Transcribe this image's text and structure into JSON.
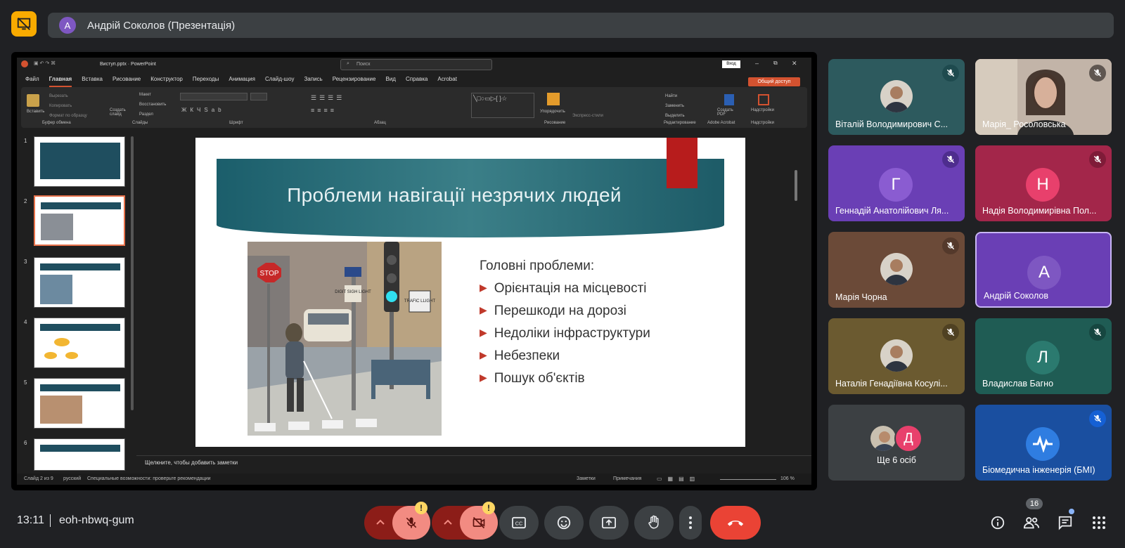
{
  "presenter": {
    "avatar_letter": "А",
    "label": "Андрій Соколов (Презентація)"
  },
  "ppt": {
    "filename": "Виступ.pptx  ·  PowerPoint",
    "search_placeholder": "Поиск",
    "signin": "Вход",
    "share": "Общий доступ",
    "menu": [
      "Файл",
      "Главная",
      "Вставка",
      "Рисование",
      "Конструктор",
      "Переходы",
      "Анимация",
      "Слайд-шоу",
      "Запись",
      "Рецензирование",
      "Вид",
      "Справка",
      "Acrobat"
    ],
    "ribbon_groups": [
      "Буфер обмена",
      "Слайды",
      "Шрифт",
      "Абзац",
      "Рисование",
      "Редактирование",
      "Adobe Acrobat",
      "Надстройки"
    ],
    "ribbon_items": {
      "paste": "Вставить",
      "cut": "Вырезать",
      "copy": "Копировать",
      "format": "Формат по образцу",
      "new_slide": "Создать слайд",
      "layout": "Макет",
      "reset": "Восстановить",
      "section": "Раздел",
      "find": "Найти",
      "replace": "Заменить",
      "select": "Выделить",
      "arrange": "Упорядочить",
      "express_styles": "Экспресс-стили",
      "create_pdf": "Создать PDF",
      "addins": "Надстройки"
    },
    "thumb_numbers": [
      "1",
      "2",
      "3",
      "4",
      "5",
      "6"
    ],
    "notes_placeholder": "Щелкните, чтобы добавить заметки",
    "status": {
      "slide": "Слайд 2 из 9",
      "lang": "русский",
      "access": "Специальные возможности: проверьте рекомендации",
      "notes": "Заметки",
      "comments": "Примечания",
      "zoom": "106 %"
    }
  },
  "slide": {
    "title": "Проблеми навігації незрячих людей",
    "subhead": "Головні проблеми:",
    "bullets": [
      "Орієнтація на місцевості",
      "Перешкоди на дорозі",
      "Недоліки інфраструктури",
      "Небезпеки",
      "Пошук об'єктів"
    ],
    "image_signs": {
      "stop": "STOP",
      "digit": "DIGIT SIGH LIGHT",
      "trafic": "TRAFIC LLIGHT"
    }
  },
  "participants": [
    {
      "name": "Віталій Володимирович С...",
      "type": "photo",
      "bg": "#2d5a5e",
      "mute": "#1e4a4e"
    },
    {
      "name": "Марія_ Росоловська",
      "type": "photo-camera",
      "bg": "#b8a89c",
      "mute": "#5f5650"
    },
    {
      "name": "Геннадій Анатолійович Ля...",
      "type": "letter",
      "letter": "Г",
      "bg": "#6a3fb5",
      "circle": "#8a5cd1",
      "mute": "#4e2d8e"
    },
    {
      "name": "Надія Володимирівна Пол...",
      "type": "letter",
      "letter": "Н",
      "bg": "#a3264a",
      "circle": "#e8406c",
      "mute": "#7f1b38"
    },
    {
      "name": "Марія Чорна",
      "type": "photo",
      "bg": "#6b4a38",
      "mute": "#54392b"
    },
    {
      "name": "Андрій Соколов",
      "type": "letter",
      "letter": "А",
      "bg": "#6a3fb5",
      "circle": "#7e57c2",
      "mute": ""
    },
    {
      "name": "Наталія Генадіївна Косулі...",
      "type": "photo",
      "bg": "#6b5a30",
      "mute": "#4f4122"
    },
    {
      "name": "Владислав Багно",
      "type": "letter",
      "letter": "Л",
      "bg": "#1f5c54",
      "circle": "#2b7a6f",
      "mute": "#164640"
    },
    {
      "name": "Ще 6 осіб",
      "type": "others",
      "letter": "Д",
      "bg": "#3c4043",
      "mute": ""
    },
    {
      "name": "Біомедична інженерія (БМІ)",
      "type": "logo",
      "bg": "#1a4fa0",
      "mute": "#1560d4"
    }
  ],
  "bottom": {
    "time": "13:11",
    "code": "eoh-nbwq-gum",
    "participants_count": "16",
    "warn": "!"
  },
  "colors": {
    "end_call": "#ea4335",
    "muted_btn": "#f28b82",
    "dark_red": "#8c1d18",
    "control": "#3c4043"
  }
}
